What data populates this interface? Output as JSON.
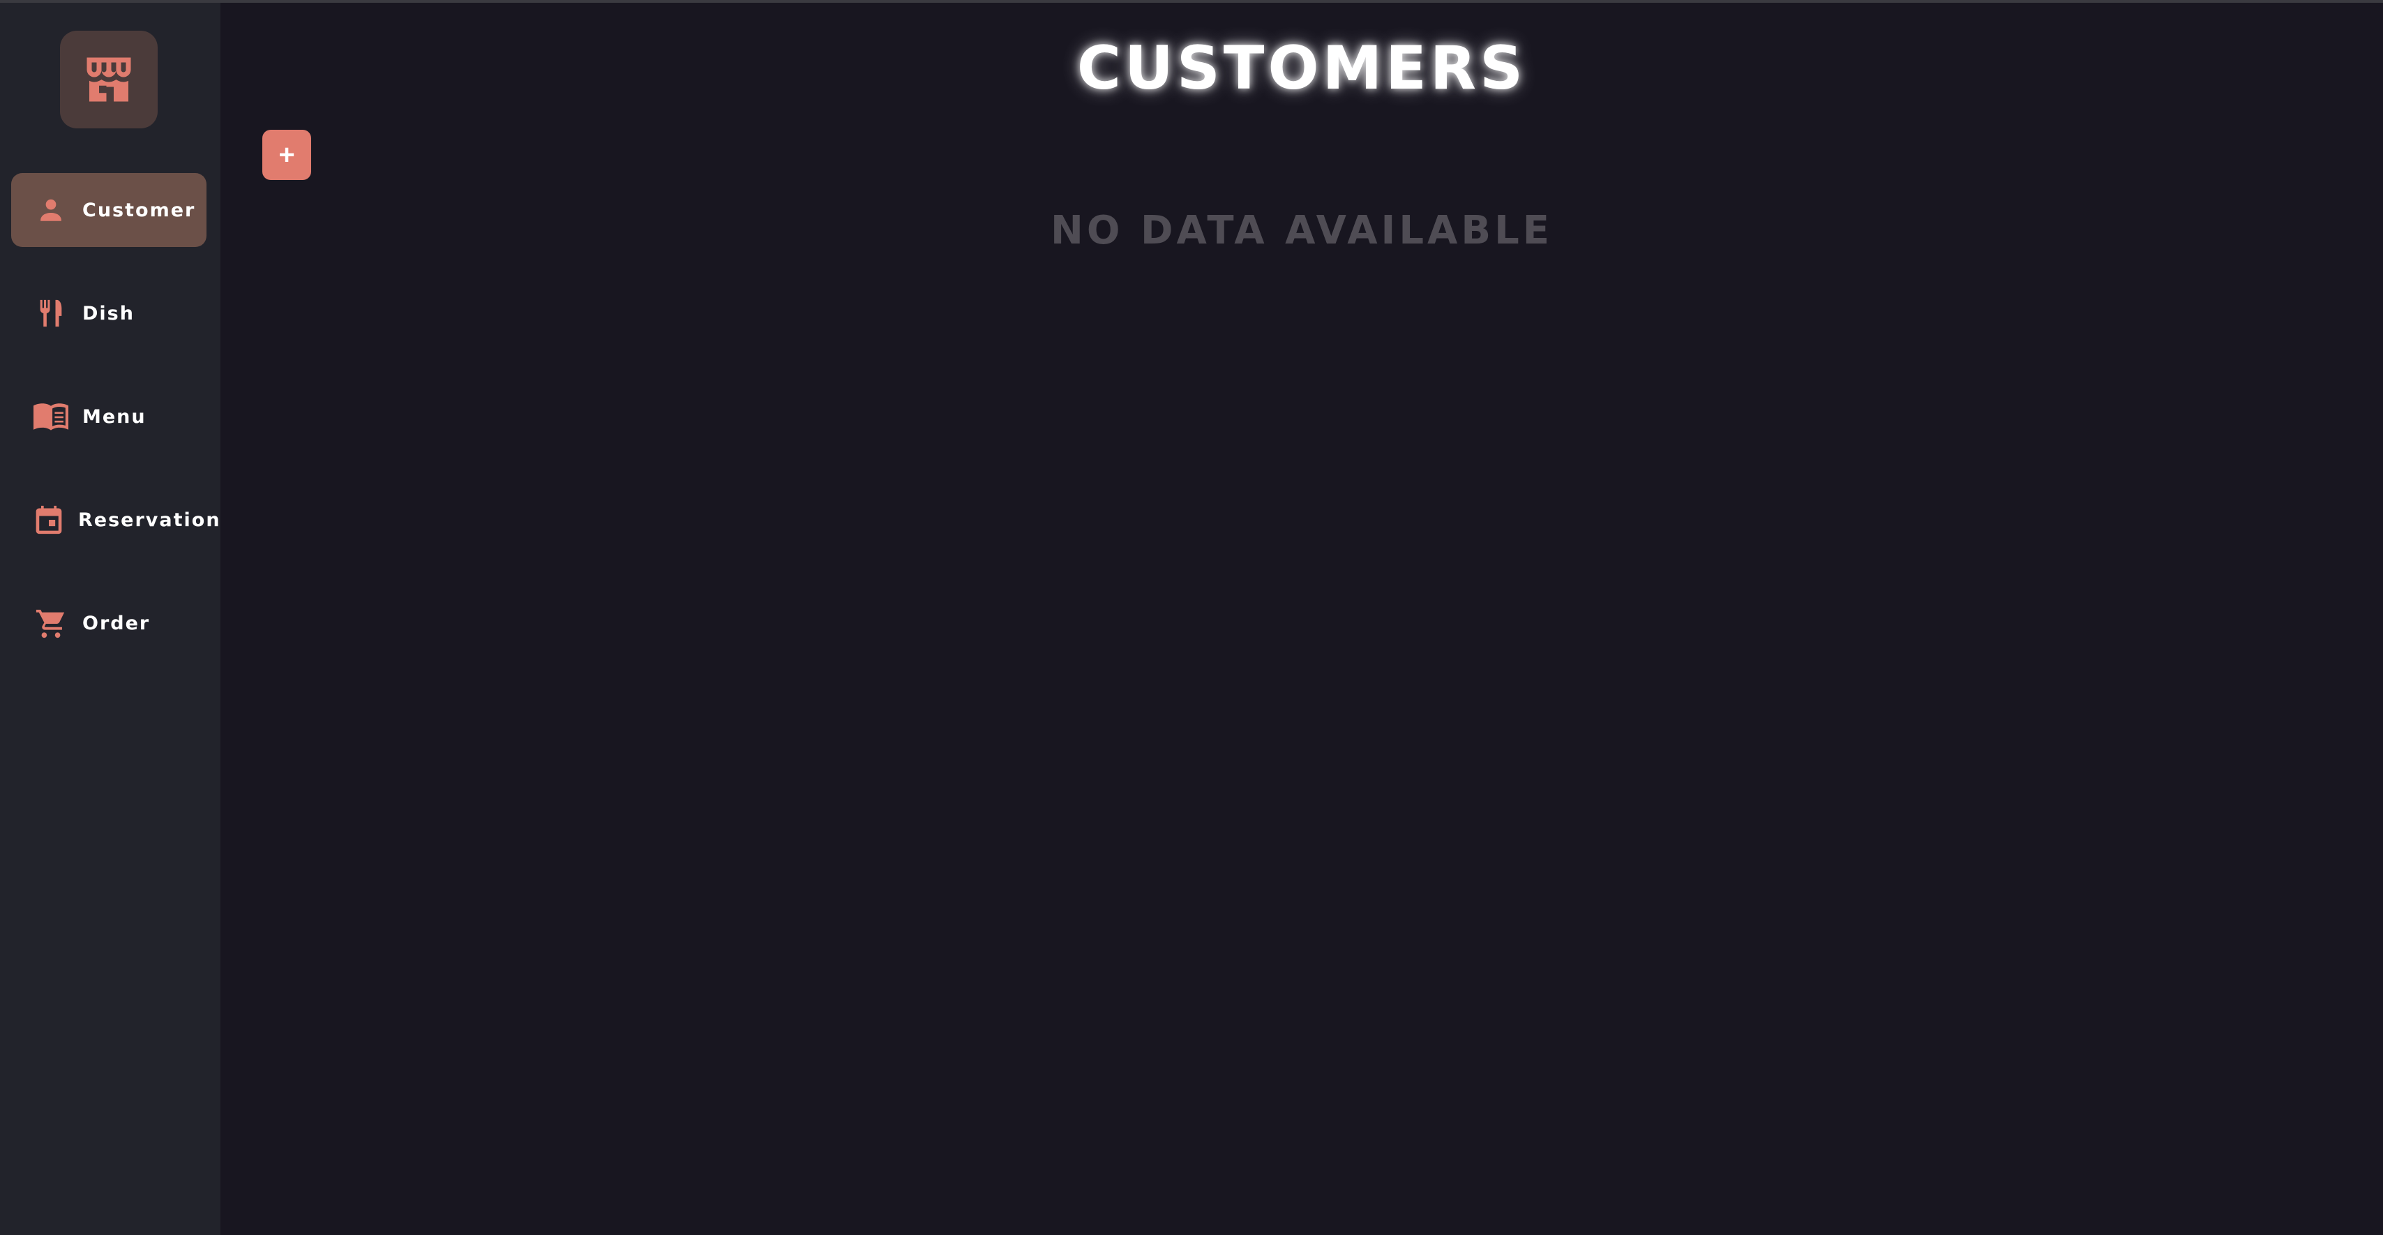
{
  "colors": {
    "accent": "#e17c6e",
    "sidebar_bg": "#22232b",
    "main_bg": "#181620",
    "active_item_bg": "#6b5048",
    "logo_tile_bg": "#4b3b3a",
    "empty_text": "#4f4c54"
  },
  "sidebar": {
    "logo_icon": "storefront-icon",
    "items": [
      {
        "label": "Customer",
        "icon": "person-icon",
        "active": true
      },
      {
        "label": "Dish",
        "icon": "fork-knife-icon",
        "active": false
      },
      {
        "label": "Menu",
        "icon": "open-book-icon",
        "active": false
      },
      {
        "label": "Reservation",
        "icon": "calendar-icon",
        "active": false
      },
      {
        "label": "Order",
        "icon": "shopping-cart-icon",
        "active": false
      }
    ]
  },
  "main": {
    "title": "CUSTOMERS",
    "add_button_label": "+",
    "empty_message": "NO DATA AVAILABLE"
  }
}
